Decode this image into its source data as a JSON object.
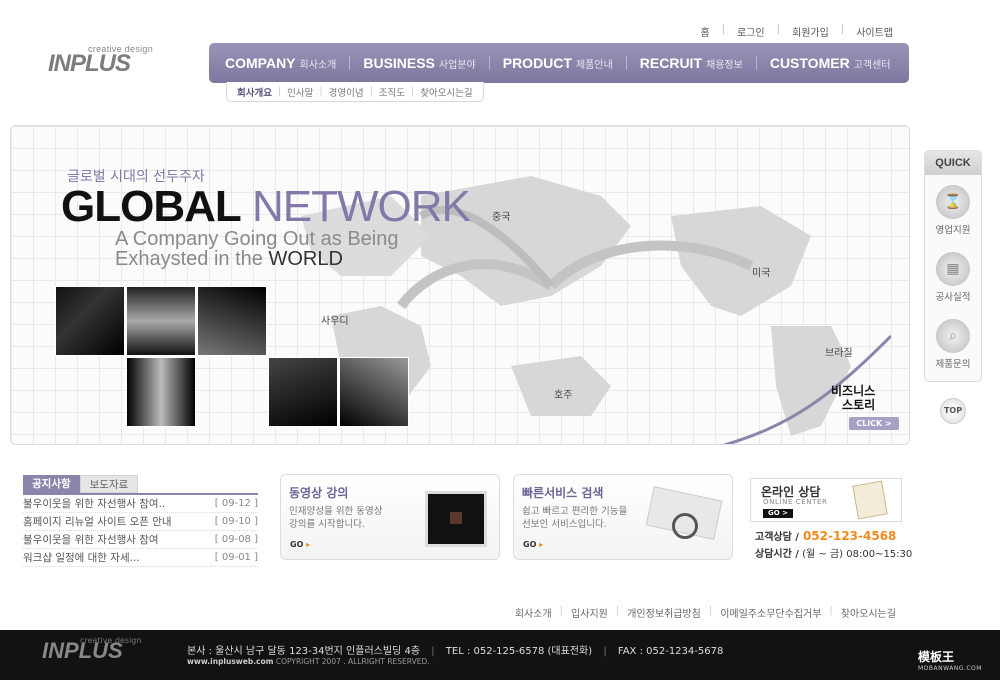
{
  "logo": {
    "tagline": "creative design",
    "name": "INPLUS"
  },
  "util_links": [
    "홈",
    "로그인",
    "회원가입",
    "사이트맵"
  ],
  "nav": [
    {
      "en": "COMPANY",
      "ko": "회사소개"
    },
    {
      "en": "BUSINESS",
      "ko": "사업분야"
    },
    {
      "en": "PRODUCT",
      "ko": "제품안내"
    },
    {
      "en": "RECRUIT",
      "ko": "채용정보"
    },
    {
      "en": "CUSTOMER",
      "ko": "고객센터"
    }
  ],
  "subnav": [
    "회사개요",
    "인사말",
    "경영이념",
    "조직도",
    "찾아오시는길"
  ],
  "banner": {
    "slogan_kr": "글로벌 시대의 선두주자",
    "title_bold": "GLOBAL",
    "title_light": "NETWORK",
    "line1": "A Company Going Out as Being",
    "line2_prefix": "Exhaysted in the",
    "line2_strong": "WORLD",
    "cities": {
      "china": "중국",
      "saudi": "사우디",
      "usa": "미국",
      "brazil": "브라질",
      "australia": "호주"
    },
    "business_story": [
      "비즈니스",
      "스토리"
    ],
    "click": "CLICK >"
  },
  "quick": {
    "title": "QUICK",
    "items": [
      {
        "label": "영업지원",
        "icon": "hourglass-icon"
      },
      {
        "label": "공사실적",
        "icon": "calendar-icon"
      },
      {
        "label": "제품문의",
        "icon": "magnifier-icon"
      }
    ],
    "top": "TOP"
  },
  "notice": {
    "tabs": [
      "공지사항",
      "보도자료"
    ],
    "items": [
      {
        "title": "불우이웃을 위한 자선행사 참여..",
        "date": "[ 09-12 ]"
      },
      {
        "title": "홈페이지 리뉴얼 사이트 오픈 안내",
        "date": "[ 09-10 ]"
      },
      {
        "title": "불우이웃을 위한 자선행사 참여",
        "date": "[ 09-08 ]"
      },
      {
        "title": "워크샵 일정에 대한 자세...",
        "date": "[ 09-01 ]"
      }
    ]
  },
  "video": {
    "title": "동영상 강의",
    "desc": [
      "인재양성을 위한 동영상",
      "강의를 시작합니다."
    ],
    "go": "GO"
  },
  "search": {
    "title": "빠른서비스 검색",
    "desc": [
      "쉽고 빠르고 편리한 기능을",
      "선보인 서비스입니다."
    ],
    "go": "GO"
  },
  "consult": {
    "title": "온라인 상담",
    "subtitle": "ONLINE CENTER",
    "go": "GO >",
    "phone_label": "고객상담 /",
    "phone": "052-123-4568",
    "hours_label": "상담시간 /",
    "hours": "(월 ~ 금) 08:00~15:30"
  },
  "footer_links": [
    "회사소개",
    "입사지원",
    "개인정보취급방침",
    "이메일주소무단수집거부",
    "찾아오시는길"
  ],
  "footer": {
    "logo_tag": "creative design",
    "logo": "INPLUS",
    "address": "본사 : 울산시 남구 달동 123-34번지 인플러스빌딩 4층",
    "tel": "TEL : 052-125-6578 (대표전화)",
    "fax": "FAX : 052-1234-5678",
    "site": "www.inplusweb.com",
    "copyright": "COPYRIGHT 2007 . ALLRIGHT RESERVED.",
    "watermark": "模板王",
    "watermark_sub": "MOBANWANG.COM"
  },
  "colors": {
    "accent": "#8c84ab",
    "highlight": "#f08a1c"
  }
}
